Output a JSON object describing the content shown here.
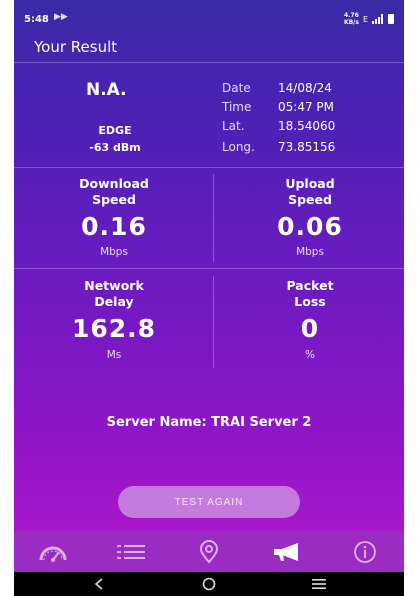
{
  "status": {
    "time": "5:48",
    "media_indicator": "▶▶",
    "net_speed_top": "4.76",
    "net_speed_bottom": "KB/s",
    "network_label": "E"
  },
  "header": {
    "title": "Your Result"
  },
  "network": {
    "status": "N.A.",
    "type": "EDGE",
    "signal": "-63 dBm"
  },
  "info": {
    "date_label": "Date",
    "date_value": "14/08/24",
    "time_label": "Time",
    "time_value": "05:47 PM",
    "lat_label": "Lat.",
    "lat_value": "18.54060",
    "long_label": "Long.",
    "long_value": "73.85156"
  },
  "metrics": {
    "download": {
      "label_line1": "Download",
      "label_line2": "Speed",
      "value": "0.16",
      "unit": "Mbps"
    },
    "upload": {
      "label_line1": "Upload",
      "label_line2": "Speed",
      "value": "0.06",
      "unit": "Mbps"
    },
    "delay": {
      "label_line1": "Network",
      "label_line2": "Delay",
      "value": "162.8",
      "unit": "Ms"
    },
    "loss": {
      "label_line1": "Packet",
      "label_line2": "Loss",
      "value": "0",
      "unit": "%"
    }
  },
  "server": {
    "text": "Server Name: TRAI Server 2"
  },
  "actions": {
    "test_again": "TEST AGAIN"
  },
  "tabs": [
    {
      "icon": "speedometer-icon"
    },
    {
      "icon": "list-icon"
    },
    {
      "icon": "location-pin-icon"
    },
    {
      "icon": "megaphone-icon",
      "active": true
    },
    {
      "icon": "info-icon"
    }
  ],
  "colors": {
    "accent_button": "#c57ae0",
    "tab_bar": "#9a2cc3",
    "gradient_top": "#3a2aa6",
    "gradient_bottom": "#a517c9"
  }
}
